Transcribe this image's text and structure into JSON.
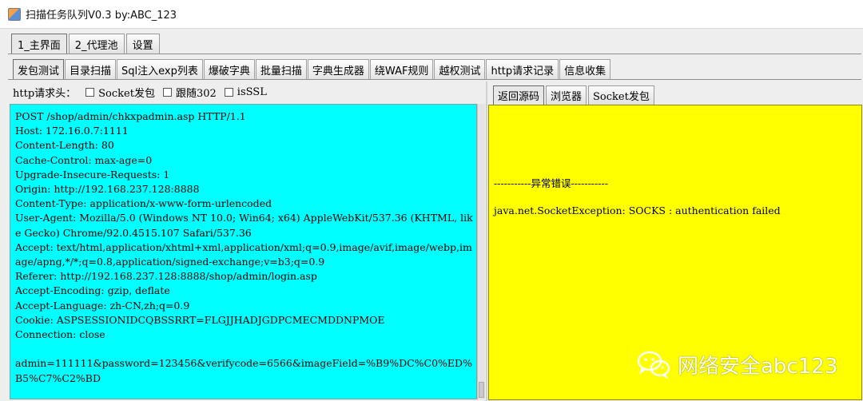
{
  "window": {
    "title": "扫描任务队列V0.3 by:ABC_123"
  },
  "main_tabs": [
    {
      "label": "1_主界面",
      "active": true
    },
    {
      "label": "2_代理池",
      "active": false
    },
    {
      "label": "设置",
      "active": false
    }
  ],
  "func_tabs": [
    {
      "label": "发包测试",
      "active": true
    },
    {
      "label": "目录扫描",
      "active": false
    },
    {
      "label": "Sql注入exp列表",
      "active": false
    },
    {
      "label": "爆破字典",
      "active": false
    },
    {
      "label": "批量扫描",
      "active": false
    },
    {
      "label": "字典生成器",
      "active": false
    },
    {
      "label": "绕WAF规则",
      "active": false
    },
    {
      "label": "越权测试",
      "active": false
    },
    {
      "label": "http请求记录",
      "active": false
    },
    {
      "label": "信息收集",
      "active": false
    }
  ],
  "request_panel": {
    "header_label": "http请求头：",
    "checkboxes": [
      {
        "label": "Socket发包",
        "checked": false
      },
      {
        "label": "跟随302",
        "checked": false
      },
      {
        "label": "isSSL",
        "checked": false
      }
    ],
    "content": "POST /shop/admin/chkxpadmin.asp HTTP/1.1\nHost: 172.16.0.7:1111\nContent-Length: 80\nCache-Control: max-age=0\nUpgrade-Insecure-Requests: 1\nOrigin: http://192.168.237.128:8888\nContent-Type: application/x-www-form-urlencoded\nUser-Agent: Mozilla/5.0 (Windows NT 10.0; Win64; x64) AppleWebKit/537.36 (KHTML, like Gecko) Chrome/92.0.4515.107 Safari/537.36\nAccept: text/html,application/xhtml+xml,application/xml;q=0.9,image/avif,image/webp,image/apng,*/*;q=0.8,application/signed-exchange;v=b3;q=0.9\nReferer: http://192.168.237.128:8888/shop/admin/login.asp\nAccept-Encoding: gzip, deflate\nAccept-Language: zh-CN,zh;q=0.9\nCookie: ASPSESSIONIDCQBSSRRT=FLGJJHADJGDPCMECMDDNPMOE\nConnection: close\n\nadmin=111111&password=123456&verifycode=6566&imageField=%B9%DC%C0%ED%B5%C7%C2%BD",
    "background": "#00ffff"
  },
  "response_panel": {
    "tabs": [
      {
        "label": "返回源码",
        "active": true
      },
      {
        "label": "浏览器",
        "active": false
      },
      {
        "label": "Socket发包",
        "active": false
      }
    ],
    "error_title": "-----------异常错误-----------",
    "error_message": "java.net.SocketException: SOCKS : authentication failed",
    "background": "#ffff00"
  },
  "watermark": {
    "text": "网络安全abc123",
    "icon": "wechat-icon"
  }
}
